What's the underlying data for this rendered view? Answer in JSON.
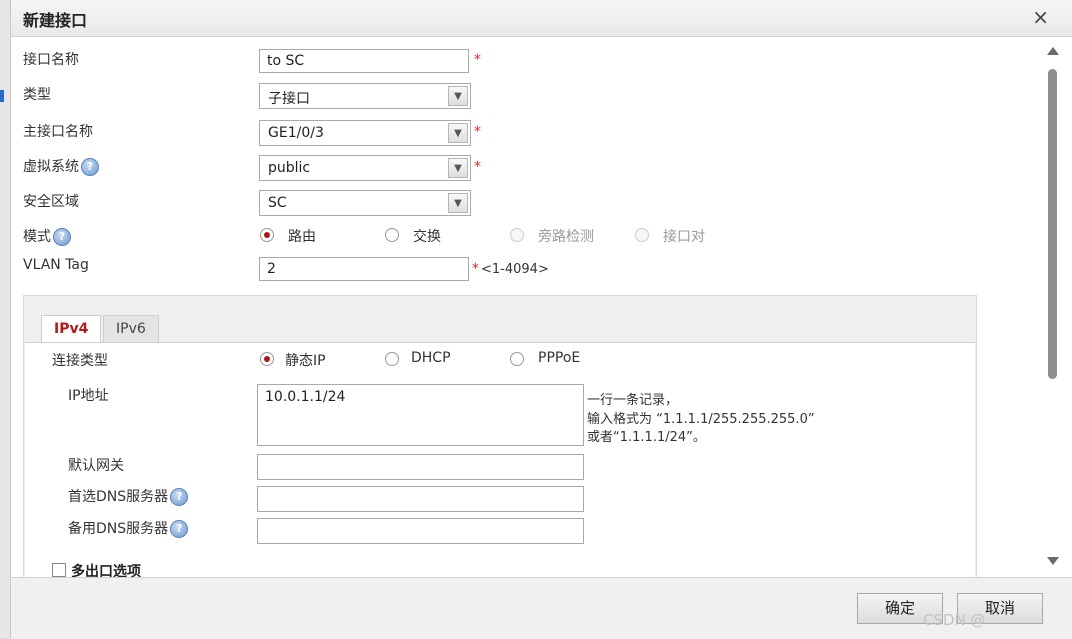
{
  "dialog": {
    "title": "新建接口",
    "close_glyph": "×"
  },
  "form": {
    "interface_name": {
      "label": "接口名称",
      "value": "to SC",
      "required": "*"
    },
    "type": {
      "label": "类型",
      "value": "子接口"
    },
    "parent_interface": {
      "label": "主接口名称",
      "value": "GE1/0/3",
      "required": "*"
    },
    "virtual_system": {
      "label": "虚拟系统",
      "value": "public",
      "required": "*"
    },
    "security_zone": {
      "label": "安全区域",
      "value": "SC"
    },
    "mode": {
      "label": "模式",
      "options": [
        "路由",
        "交换",
        "旁路检测",
        "接口对"
      ],
      "selected": "路由"
    },
    "vlan_tag": {
      "label": "VLAN Tag",
      "value": "2",
      "required": "*",
      "range": "<1-4094>"
    }
  },
  "tabs": [
    "IPv4",
    "IPv6"
  ],
  "ipv4": {
    "connection_type": {
      "label": "连接类型",
      "options": [
        "静态IP",
        "DHCP",
        "PPPoE"
      ],
      "selected": "静态IP"
    },
    "ip_address": {
      "label": "IP地址",
      "value": "10.0.1.1/24"
    },
    "ip_hint": [
      "一行一条记录，",
      "输入格式为 “1.1.1.1/255.255.255.0”",
      "或者“1.1.1.1/24”。"
    ],
    "default_gateway": {
      "label": "默认网关",
      "value": ""
    },
    "primary_dns": {
      "label": "首选DNS服务器",
      "value": ""
    },
    "backup_dns": {
      "label": "备用DNS服务器",
      "value": ""
    },
    "multi_exit": {
      "label": "多出口选项"
    }
  },
  "help_glyph": "?",
  "footer": {
    "ok": "确定",
    "cancel": "取消",
    "watermark": "CSDN @"
  },
  "colors": {
    "required": "#e0262a",
    "active_tab": "#b31b1b",
    "radio_dot": "#b01515"
  }
}
